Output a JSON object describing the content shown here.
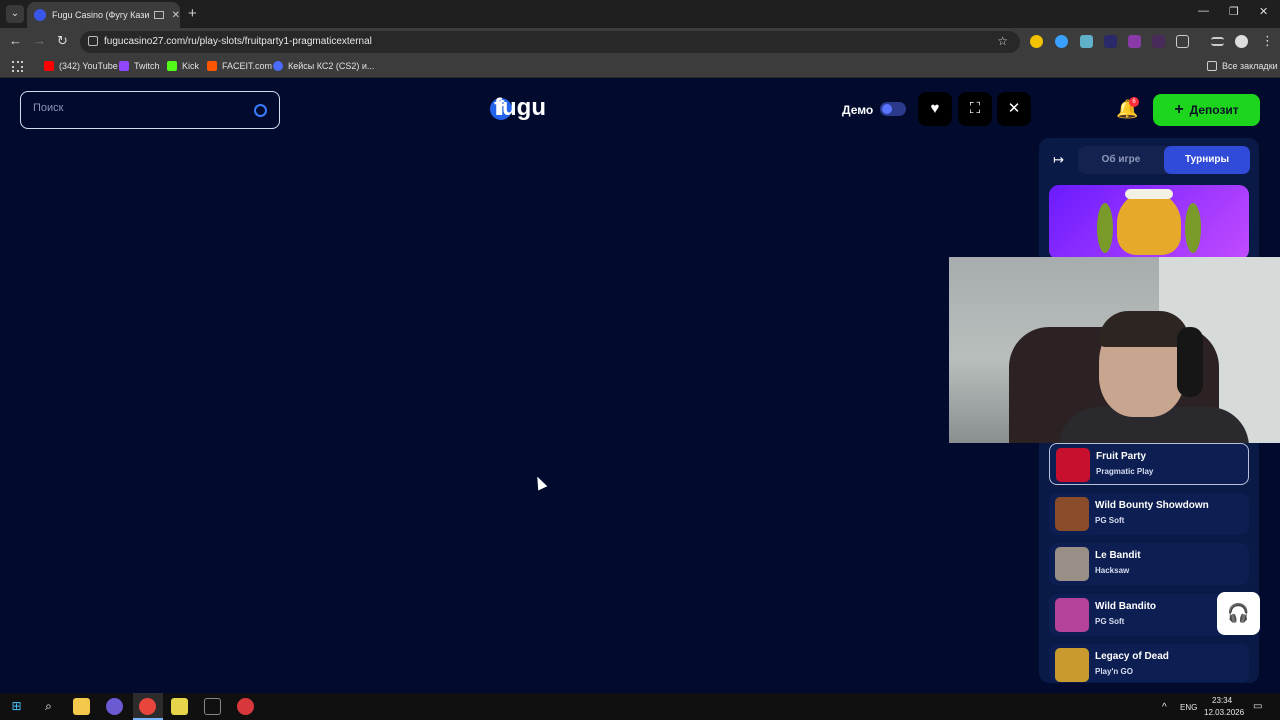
{
  "browser": {
    "tab_title": "Fugu Casino (Фугу Казино)",
    "url": "fugucasino27.com/ru/play-slots/fruitparty1-pragmaticexternal",
    "bookmarks": [
      {
        "label": "(342) YouTube",
        "color": "#ff0000"
      },
      {
        "label": "Twitch",
        "color": "#9146ff"
      },
      {
        "label": "Kick",
        "color": "#53fc18"
      },
      {
        "label": "FACEIT.com",
        "color": "#ff5500"
      },
      {
        "label": "Кейсы КС2 (CS2) и...",
        "color": "#4a6cff"
      }
    ],
    "all_bookmarks": "Все закладки"
  },
  "header": {
    "search_placeholder": "Поиск",
    "logo": "fugu",
    "demo_label": "Демо",
    "notification_count": "6",
    "deposit_label": "Депозит"
  },
  "colors": {
    "page_bg": "#020b2e",
    "deposit": "#1ed51e",
    "active_tab": "#2f4bd8"
  },
  "panel": {
    "tabs": [
      {
        "label": "Об игре",
        "active": false
      },
      {
        "label": "Турниры",
        "active": true
      }
    ],
    "games": [
      {
        "name": "Fruit Party",
        "provider": "Pragmatic Play",
        "active": true,
        "color": "#c8102e"
      },
      {
        "name": "Wild Bounty Showdown",
        "provider": "PG Soft",
        "active": false,
        "color": "#8a4b2a"
      },
      {
        "name": "Le Bandit",
        "provider": "Hacksaw",
        "active": false,
        "color": "#9a8f86"
      },
      {
        "name": "Wild Bandito",
        "provider": "PG Soft",
        "active": false,
        "color": "#b4429a"
      },
      {
        "name": "Legacy of Dead",
        "provider": "Play'n GO",
        "active": false,
        "color": "#c99a2e"
      }
    ]
  },
  "taskbar": {
    "language": "ENG",
    "time": "23:34",
    "date": "12.03.2026"
  }
}
